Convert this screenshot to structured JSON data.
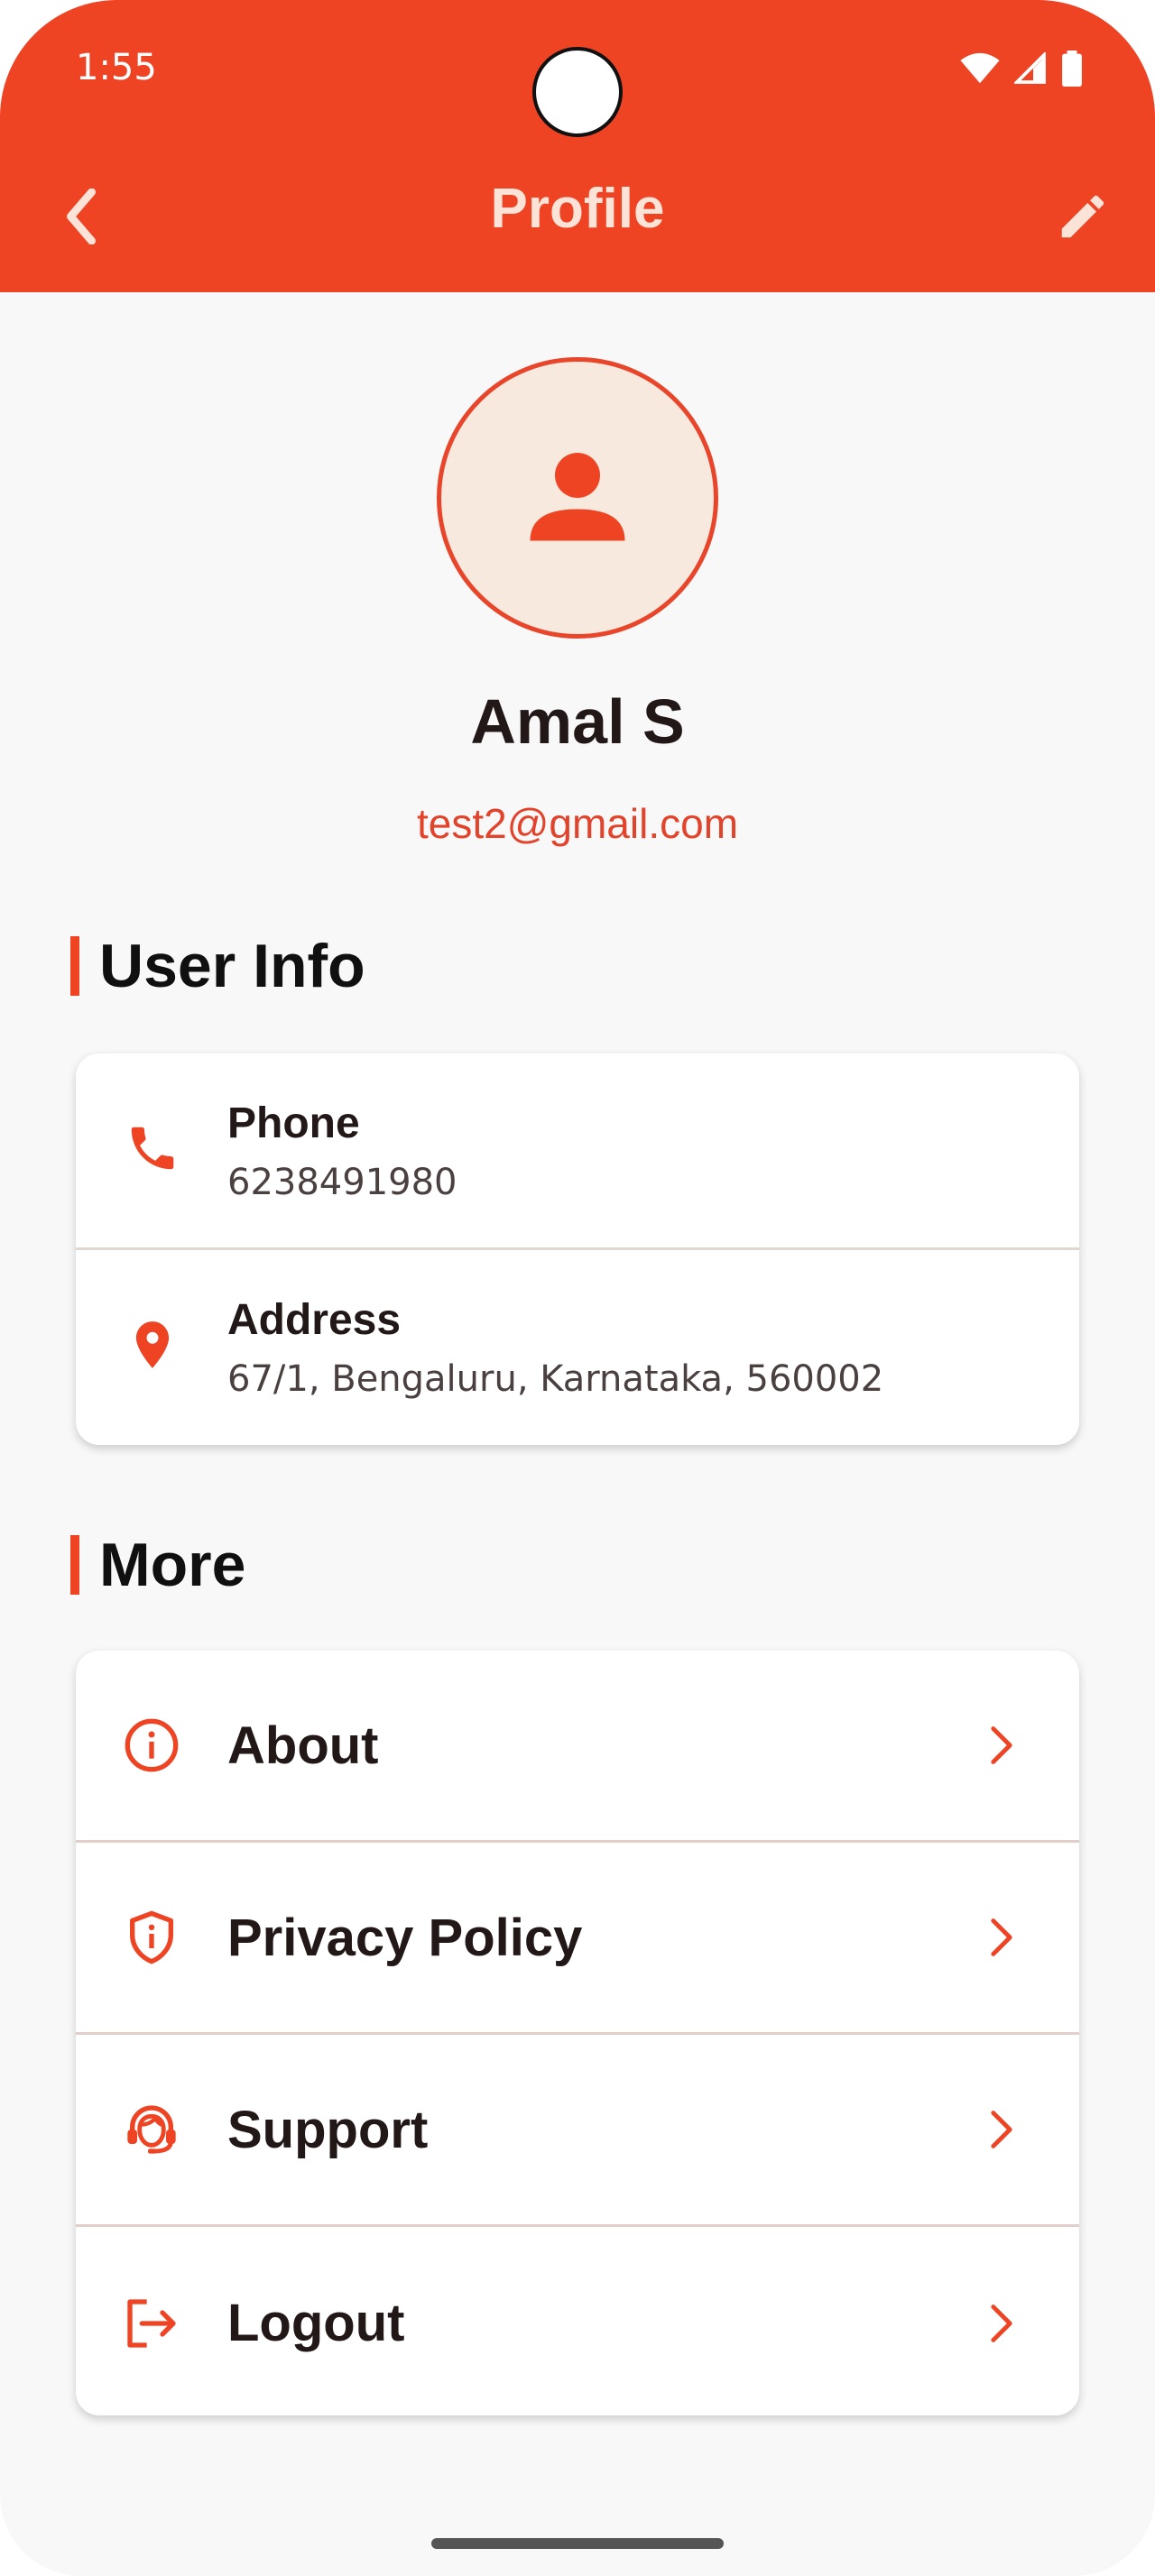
{
  "status_bar": {
    "time": "1:55"
  },
  "header": {
    "title": "Profile"
  },
  "profile": {
    "name": "Amal S",
    "email": "test2@gmail.com"
  },
  "user_info": {
    "title": "User Info",
    "items": [
      {
        "icon": "phone-icon",
        "label": "Phone",
        "value": "6238491980"
      },
      {
        "icon": "location-pin-icon",
        "label": "Address",
        "value": "67/1, Bengaluru, Karnataka, 560002"
      }
    ]
  },
  "more": {
    "title": "More",
    "items": [
      {
        "icon": "info-icon",
        "label": "About"
      },
      {
        "icon": "shield-icon",
        "label": "Privacy Policy"
      },
      {
        "icon": "support-agent-icon",
        "label": "Support"
      },
      {
        "icon": "logout-icon",
        "label": "Logout"
      }
    ]
  },
  "colors": {
    "accent": "#ee4424",
    "avatar_bg": "#f8e9de",
    "background": "#f8f8f8",
    "text": "#231818"
  }
}
